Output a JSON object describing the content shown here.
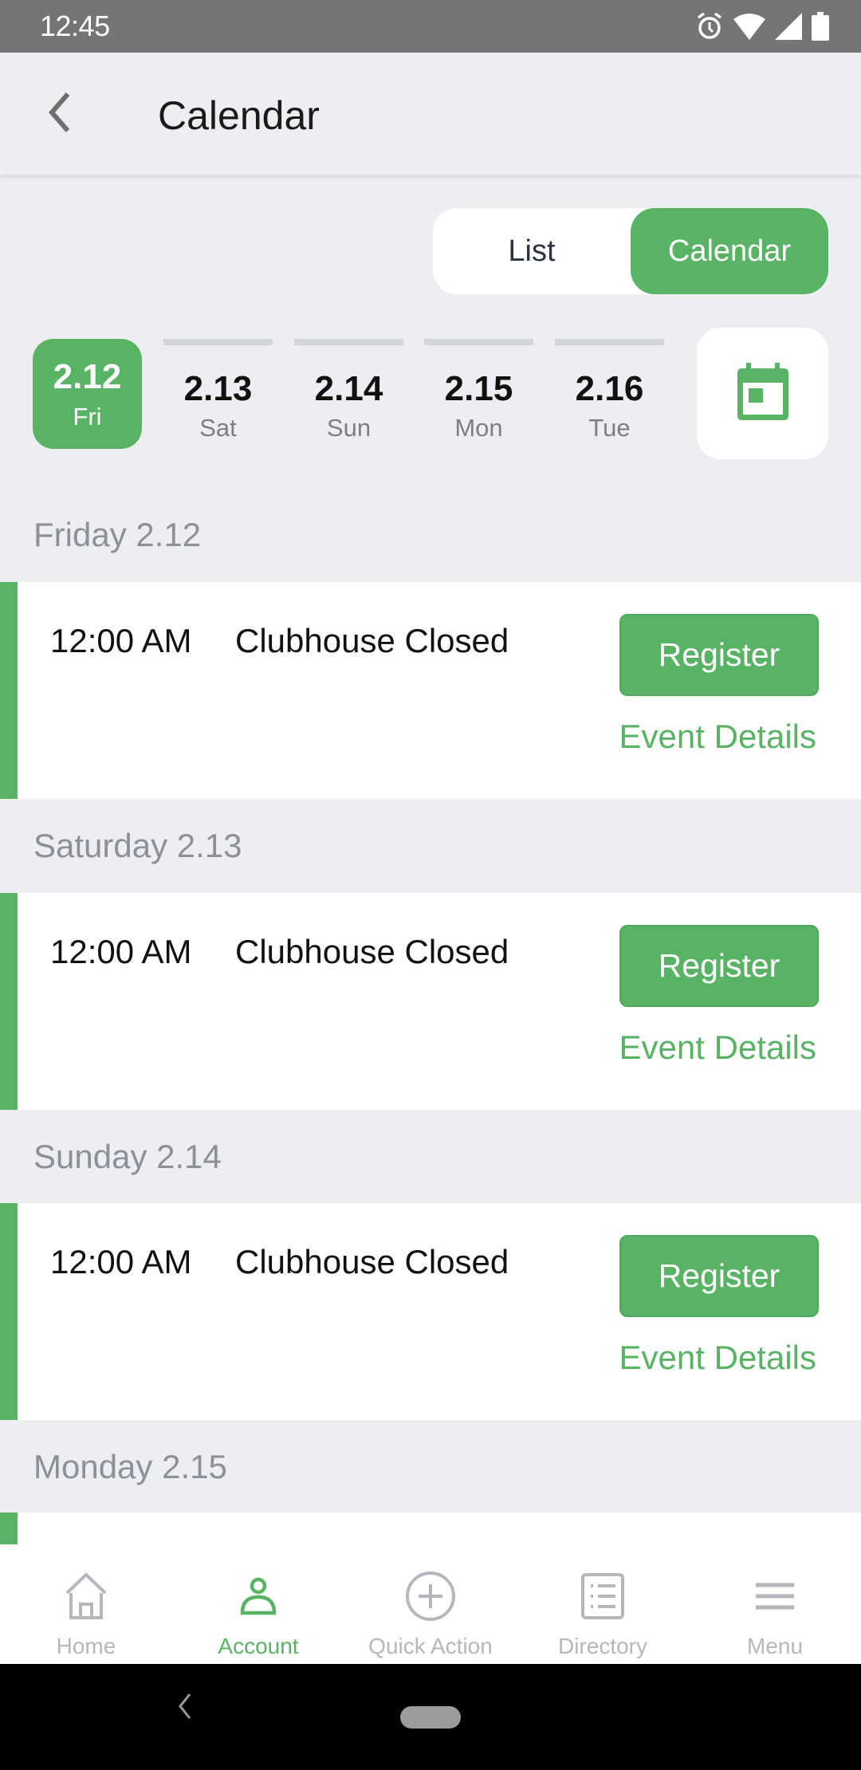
{
  "status_bar": {
    "time": "12:45",
    "icons": [
      "alarm-icon",
      "wifi-icon",
      "signal-icon",
      "battery-icon"
    ]
  },
  "app_bar": {
    "title": "Calendar",
    "back_icon": "chevron-left-icon"
  },
  "view_toggle": {
    "options": [
      {
        "label": "List",
        "active": false
      },
      {
        "label": "Calendar",
        "active": true
      }
    ]
  },
  "date_strip": {
    "dates": [
      {
        "num": "2.12",
        "dow": "Fri",
        "active": true
      },
      {
        "num": "2.13",
        "dow": "Sat",
        "active": false
      },
      {
        "num": "2.14",
        "dow": "Sun",
        "active": false
      },
      {
        "num": "2.15",
        "dow": "Mon",
        "active": false
      },
      {
        "num": "2.16",
        "dow": "Tue",
        "active": false
      }
    ],
    "picker_icon": "calendar-icon"
  },
  "days": [
    {
      "header": "Friday 2.12",
      "events": [
        {
          "time": "12:00 AM",
          "title": "Clubhouse Closed",
          "register_label": "Register",
          "details_label": "Event Details"
        }
      ]
    },
    {
      "header": "Saturday 2.13",
      "events": [
        {
          "time": "12:00 AM",
          "title": "Clubhouse Closed",
          "register_label": "Register",
          "details_label": "Event Details"
        }
      ]
    },
    {
      "header": "Sunday 2.14",
      "events": [
        {
          "time": "12:00 AM",
          "title": "Clubhouse Closed",
          "register_label": "Register",
          "details_label": "Event Details"
        }
      ]
    },
    {
      "header": "Monday 2.15",
      "events": []
    }
  ],
  "bottom_nav": {
    "items": [
      {
        "label": "Home",
        "icon": "home-icon",
        "active": false
      },
      {
        "label": "Account",
        "icon": "account-icon",
        "active": true
      },
      {
        "label": "Quick Action",
        "icon": "plus-circle-icon",
        "active": false
      },
      {
        "label": "Directory",
        "icon": "directory-icon",
        "active": false
      },
      {
        "label": "Menu",
        "icon": "menu-icon",
        "active": false
      }
    ]
  },
  "colors": {
    "accent": "#58b365",
    "background": "#eceef2",
    "muted_text": "#8d9098",
    "nav_inactive": "#b5b7bc"
  }
}
